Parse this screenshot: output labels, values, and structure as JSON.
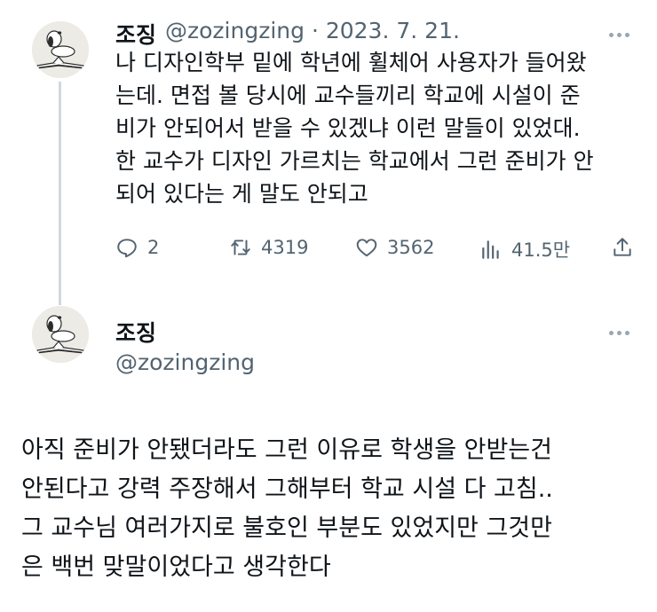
{
  "tweet1": {
    "name": "조징",
    "handle": "@zozingzing",
    "separator": "·",
    "date": "2023. 7. 21.",
    "lines": [
      "나 디자인학부 밑에 학년에 휠체어 사용자가 들어왔",
      "는데. 면접 볼 당시에 교수들끼리 학교에 시설이 준",
      "비가 안되어서 받을 수 있겠냐 이런 말들이 있었대.",
      "한 교수가 디자인 가르치는 학교에서 그런 준비가 안",
      "되어 있다는 게 말도 안되고"
    ],
    "actions": {
      "replies": "2",
      "retweets": "4319",
      "likes": "3562",
      "views": "41.5만"
    }
  },
  "tweet2": {
    "name": "조징",
    "handle": "@zozingzing",
    "lines": [
      "아직 준비가 안됐더라도 그런 이유로 학생을 안받는건",
      "안된다고 강력 주장해서 그해부터 학교 시설 다 고침..",
      "그 교수님 여러가지로 불호인 부분도 있었지만 그것만",
      "은 백번 맞말이었다고 생각한다"
    ]
  },
  "icons": [
    "avatar-snoopy",
    "more-icon",
    "reply-icon",
    "retweet-icon",
    "like-icon",
    "views-icon",
    "share-icon"
  ]
}
